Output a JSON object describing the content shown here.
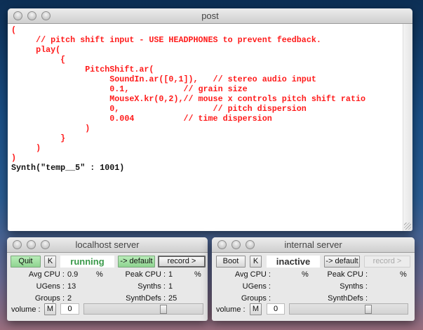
{
  "post": {
    "title": "post",
    "lines": [
      "(",
      "     // pitch shift input - USE HEADPHONES to prevent feedback.",
      "     play(",
      "          {",
      "               PitchShift.ar(",
      "                    SoundIn.ar([0,1]),   // stereo audio input",
      "                    0.1,           // grain size",
      "                    MouseX.kr(0,2),// mouse x controls pitch shift ratio",
      "                    0,                   // pitch dispersion",
      "                    0.004          // time dispersion",
      "               )",
      "          }",
      "     )",
      ")"
    ],
    "output": "Synth(\"temp__5\" : 1001)"
  },
  "servers": [
    {
      "title": "localhost server",
      "boot_label": "Quit",
      "kill_label": "K",
      "status": "running",
      "status_color": "#3a9a4a",
      "default_label": "-> default",
      "record_label": "record >",
      "avg_cpu_label": "Avg CPU :",
      "avg_cpu": "0.9",
      "peak_cpu_label": "Peak CPU :",
      "peak_cpu": "1",
      "percent": "%",
      "ugens_label": "UGens :",
      "ugens": "13",
      "synths_label": "Synths :",
      "synths": "1",
      "groups_label": "Groups :",
      "groups": "2",
      "synthdefs_label": "SynthDefs :",
      "synthdefs": "25",
      "volume_label": "volume :",
      "mute_label": "M",
      "volume": "0",
      "volume_fraction": 0.68
    },
    {
      "title": "internal server",
      "boot_label": "Boot",
      "kill_label": "K",
      "status": "inactive",
      "status_color": "#333333",
      "default_label": "-> default",
      "record_label": "record >",
      "avg_cpu_label": "Avg CPU :",
      "avg_cpu": "",
      "peak_cpu_label": "Peak CPU :",
      "peak_cpu": "",
      "percent": "%",
      "ugens_label": "UGens :",
      "ugens": "",
      "synths_label": "Synths :",
      "synths": "",
      "groups_label": "Groups :",
      "groups": "",
      "synthdefs_label": "SynthDefs :",
      "synthdefs": "",
      "volume_label": "volume :",
      "mute_label": "M",
      "volume": "0",
      "volume_fraction": 0.68
    }
  ]
}
